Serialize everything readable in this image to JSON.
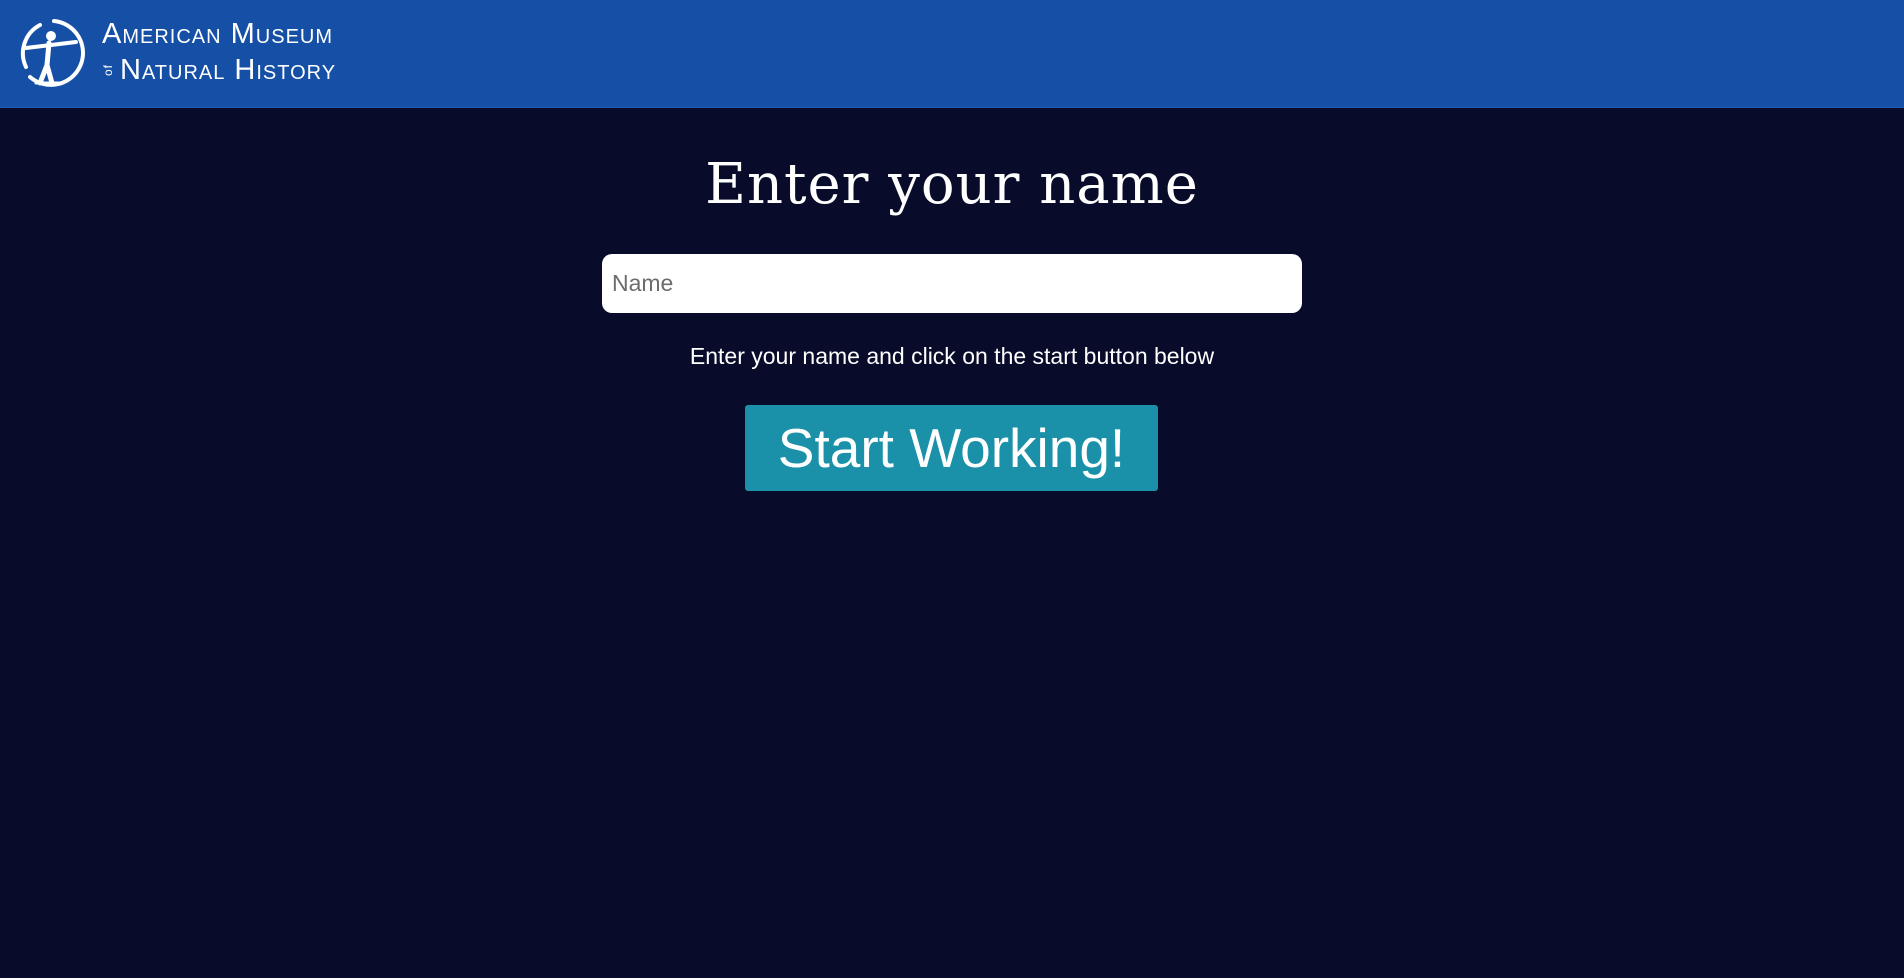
{
  "header": {
    "logo_line1": "American Museum",
    "logo_of": "of",
    "logo_line2": "Natural History",
    "background_color": "#1550a6",
    "logo_icon": "amnh-logo-icon"
  },
  "main": {
    "title": "Enter your name",
    "name_input": {
      "value": "",
      "placeholder": "Name"
    },
    "hint": "Enter your name and click on the start button below",
    "start_button_label": "Start Working!",
    "start_button_color": "#1a91a9",
    "background_color": "#080c2a"
  }
}
